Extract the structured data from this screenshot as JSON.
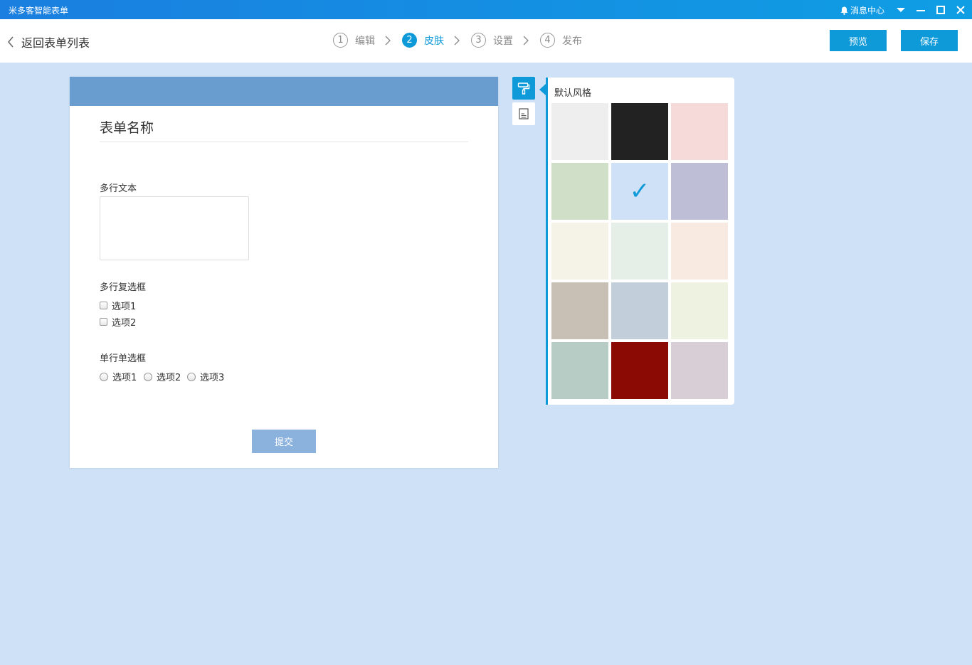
{
  "window": {
    "title": "米多客智能表单",
    "message_center": "消息中心"
  },
  "toolbar": {
    "back_label": "返回表单列表",
    "steps": [
      {
        "num": "1",
        "label": "编辑"
      },
      {
        "num": "2",
        "label": "皮肤"
      },
      {
        "num": "3",
        "label": "设置"
      },
      {
        "num": "4",
        "label": "发布"
      }
    ],
    "preview_label": "预览",
    "save_label": "保存"
  },
  "form": {
    "title": "表单名称",
    "textarea_label": "多行文本",
    "checkbox_label": "多行复选框",
    "checkbox_options": [
      "选项1",
      "选项2"
    ],
    "radio_label": "单行单选框",
    "radio_options": [
      "选项1",
      "选项2",
      "选项3"
    ],
    "submit_label": "提交"
  },
  "skin": {
    "title": "默认风格",
    "selected_index": 4,
    "check_mark": "✓",
    "colors": [
      "#eeeeee",
      "#222222",
      "#f6d9d9",
      "#d0dfc7",
      "#cfe1f7",
      "#bebed7",
      "#f5f3e8",
      "#e6efe7",
      "#f9eae1",
      "#c8c0b4",
      "#c2cfda",
      "#eef2e0",
      "#b8ccc6",
      "#8c0a04",
      "#d8ced6"
    ]
  },
  "colors": {
    "accent": "#0e9ad8",
    "form_header": "#6a9dcf",
    "background": "#cfe1f7"
  }
}
